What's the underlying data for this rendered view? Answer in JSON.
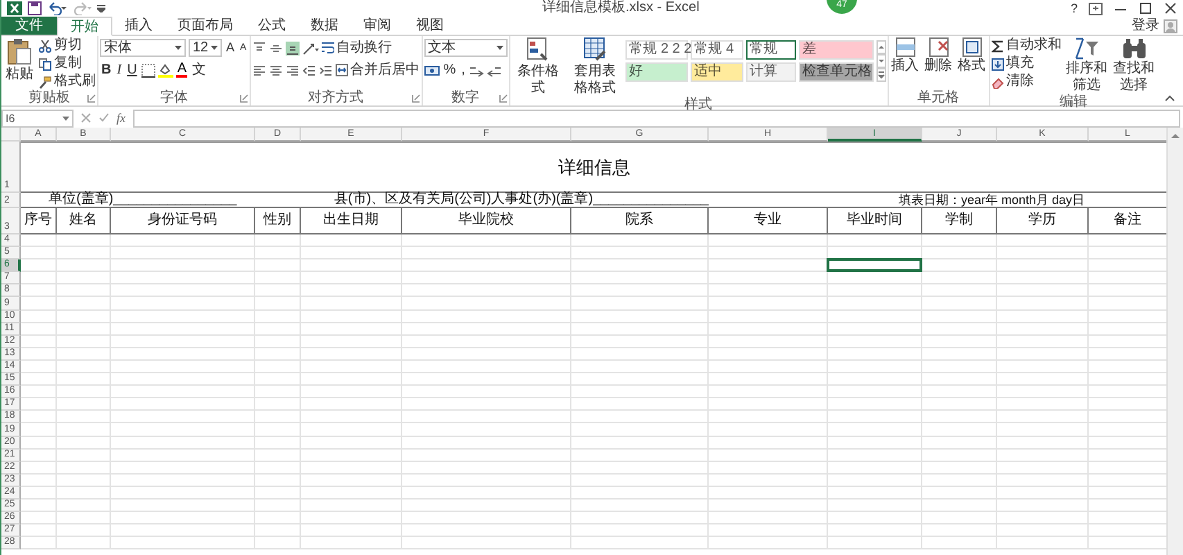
{
  "window": {
    "title": "详细信息模板.xlsx - Excel",
    "badge": "47",
    "help": "?"
  },
  "tabs": [
    {
      "label": "文件",
      "kind": "file",
      "selected": false
    },
    {
      "label": "开始",
      "kind": "tab",
      "selected": true
    },
    {
      "label": "插入",
      "kind": "tab",
      "selected": false
    },
    {
      "label": "页面布局",
      "kind": "tab",
      "selected": false
    },
    {
      "label": "公式",
      "kind": "tab",
      "selected": false
    },
    {
      "label": "数据",
      "kind": "tab",
      "selected": false
    },
    {
      "label": "审阅",
      "kind": "tab",
      "selected": false
    },
    {
      "label": "视图",
      "kind": "tab",
      "selected": false
    }
  ],
  "account": "登录",
  "clipboard": {
    "paste": "粘贴",
    "cut": "剪切",
    "copy": "复制",
    "format_painter": "格式刷",
    "label": "剪贴板"
  },
  "font": {
    "name": "宋体",
    "size": "12",
    "grow": "A",
    "shrink": "A",
    "bold": "B",
    "italic": "I",
    "underline": "U",
    "font_color": "A",
    "phonetic": "文",
    "label": "字体"
  },
  "alignment": {
    "wrap": "自动换行",
    "merge": "合并后居中",
    "label": "对齐方式"
  },
  "number": {
    "format": "文本",
    "percent": "%",
    "comma": ",",
    "label": "数字"
  },
  "styles": {
    "conditional": "条件格式",
    "table": "套用表格格式",
    "label": "样式",
    "gallery": [
      {
        "label": "常规 2 2 2",
        "color": "#ffffff",
        "selected": false
      },
      {
        "label": "常规 4",
        "color": "#ffffff",
        "selected": false
      },
      {
        "label": "常规",
        "color": "#ffffff",
        "selected": true
      },
      {
        "label": "差",
        "color": "#ffc7ce",
        "selected": false
      },
      {
        "label": "好",
        "color": "#c6efce",
        "selected": false
      },
      {
        "label": "适中",
        "color": "#ffeb9c",
        "selected": false
      },
      {
        "label": "计算",
        "color": "#f2f2f2",
        "selected": false
      },
      {
        "label": "检查单元格",
        "color": "#a5a5a5",
        "selected": false
      }
    ]
  },
  "cells": {
    "insert": "插入",
    "delete": "删除",
    "format": "格式",
    "label": "单元格"
  },
  "editing": {
    "autosum": "自动求和",
    "fill": "填充",
    "clear": "清除",
    "sort": "排序和筛选",
    "find": "查找和选择",
    "label": "编辑"
  },
  "formula_bar": {
    "name_box": "I6",
    "function_label": "fx"
  },
  "sheet": {
    "columns": [
      {
        "label": "A",
        "selected": false
      },
      {
        "label": "B",
        "selected": false
      },
      {
        "label": "C",
        "selected": false
      },
      {
        "label": "D",
        "selected": false
      },
      {
        "label": "E",
        "selected": false
      },
      {
        "label": "F",
        "selected": false
      },
      {
        "label": "G",
        "selected": false
      },
      {
        "label": "H",
        "selected": false
      },
      {
        "label": "I",
        "selected": true
      },
      {
        "label": "J",
        "selected": false
      },
      {
        "label": "K",
        "selected": false
      },
      {
        "label": "L",
        "selected": false
      }
    ],
    "rows": [
      {
        "label": "1",
        "kind": "title",
        "selected": false,
        "text": "详细信息"
      },
      {
        "label": "2",
        "kind": "info",
        "selected": false,
        "left": "单位(盖章)________________",
        "middle": "县(市)、区及有关局(公司)人事处(办)(盖章)_______________",
        "right": "填表日期：year年 month月 day日"
      },
      {
        "label": "3",
        "kind": "header",
        "selected": false,
        "cells": [
          "序号",
          "姓名",
          "身份证号码",
          "性别",
          "出生日期",
          "毕业院校",
          "院系",
          "专业",
          "毕业时间",
          "学制",
          "学历",
          "备注"
        ]
      },
      {
        "label": "4",
        "kind": "empty",
        "selected": false
      },
      {
        "label": "5",
        "kind": "empty",
        "selected": false
      },
      {
        "label": "6",
        "kind": "empty",
        "selected": true
      },
      {
        "label": "7",
        "kind": "empty",
        "selected": false
      },
      {
        "label": "8",
        "kind": "empty",
        "selected": false
      },
      {
        "label": "9",
        "kind": "empty",
        "selected": false
      },
      {
        "label": "10",
        "kind": "empty",
        "selected": false
      },
      {
        "label": "11",
        "kind": "empty",
        "selected": false
      },
      {
        "label": "12",
        "kind": "empty",
        "selected": false
      },
      {
        "label": "13",
        "kind": "empty",
        "selected": false
      },
      {
        "label": "14",
        "kind": "empty",
        "selected": false
      },
      {
        "label": "15",
        "kind": "empty",
        "selected": false
      },
      {
        "label": "16",
        "kind": "empty",
        "selected": false
      },
      {
        "label": "17",
        "kind": "empty",
        "selected": false
      },
      {
        "label": "18",
        "kind": "empty",
        "selected": false
      },
      {
        "label": "19",
        "kind": "empty",
        "selected": false
      },
      {
        "label": "20",
        "kind": "empty",
        "selected": false
      },
      {
        "label": "21",
        "kind": "empty",
        "selected": false
      },
      {
        "label": "22",
        "kind": "empty",
        "selected": false
      },
      {
        "label": "23",
        "kind": "empty",
        "selected": false
      },
      {
        "label": "24",
        "kind": "empty",
        "selected": false
      },
      {
        "label": "25",
        "kind": "empty",
        "selected": false
      },
      {
        "label": "26",
        "kind": "empty",
        "selected": false
      },
      {
        "label": "27",
        "kind": "empty",
        "selected": false
      },
      {
        "label": "28",
        "kind": "empty",
        "selected": false
      }
    ]
  }
}
